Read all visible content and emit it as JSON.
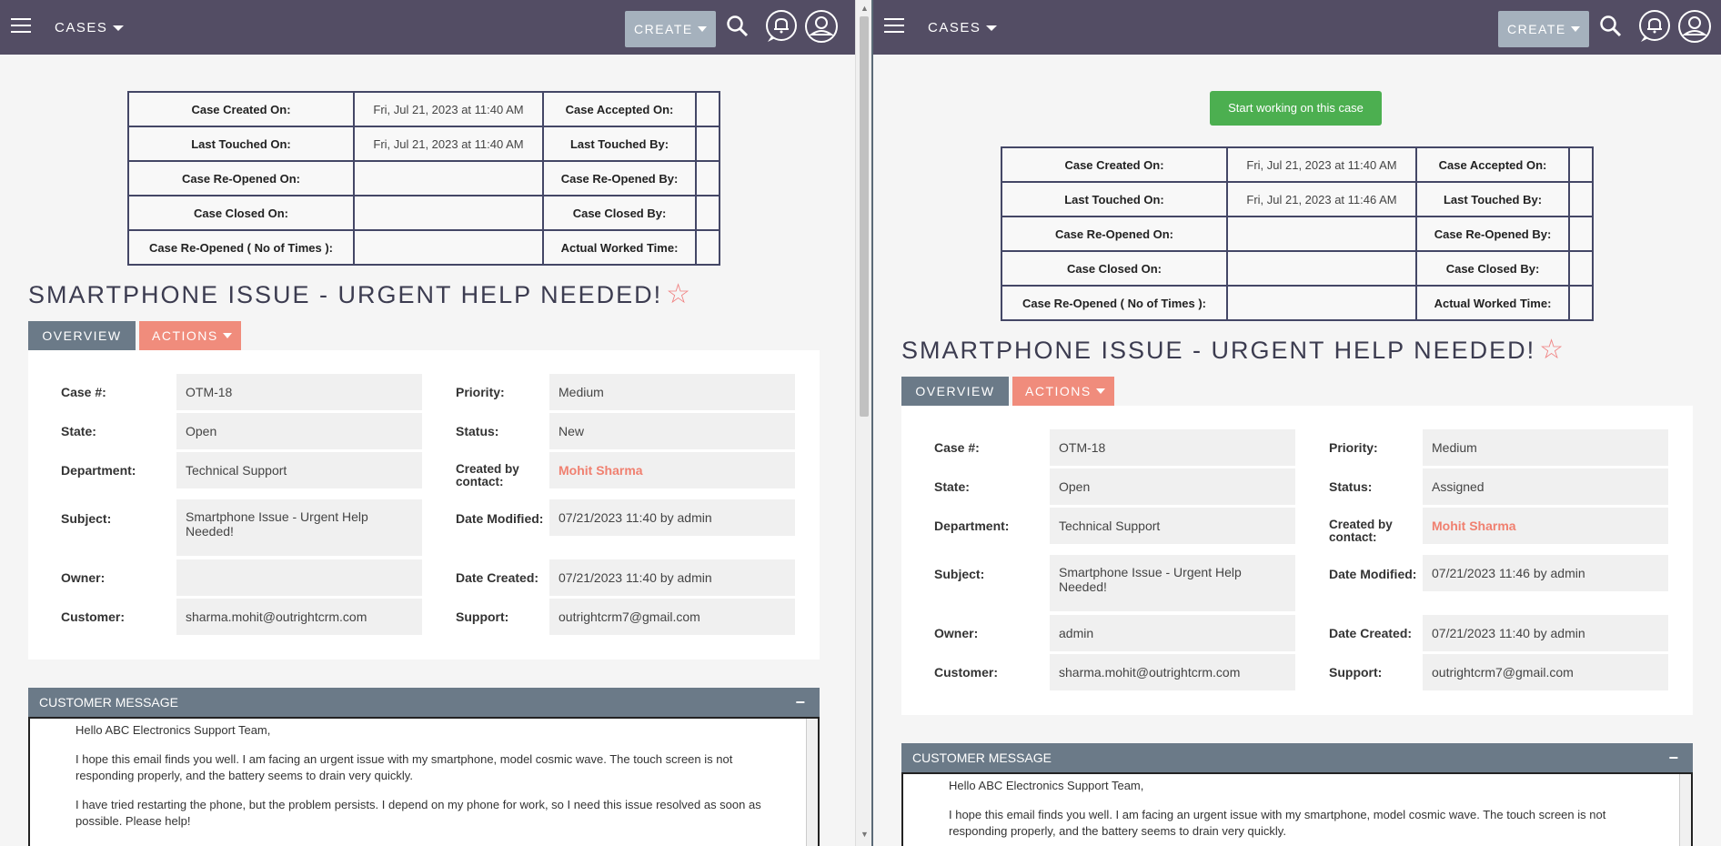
{
  "topbar": {
    "module_label": "CASES",
    "create_label": "CREATE"
  },
  "left": {
    "times": {
      "case_created_on_label": "Case Created On:",
      "case_created_on_value": "Fri, Jul 21, 2023 at 11:40 AM",
      "case_accepted_on_label": "Case Accepted On:",
      "last_touched_on_label": "Last Touched On:",
      "last_touched_on_value": "Fri, Jul 21, 2023 at 11:40 AM",
      "last_touched_by_label": "Last Touched By:",
      "case_reopened_on_label": "Case Re-Opened On:",
      "case_reopened_by_label": "Case Re-Opened By:",
      "case_closed_on_label": "Case Closed On:",
      "case_closed_by_label": "Case Closed By:",
      "case_reopened_count_label": "Case Re-Opened ( No of Times ):",
      "actual_worked_time_label": "Actual Worked Time:"
    },
    "title": "SMARTPHONE ISSUE - URGENT HELP NEEDED!",
    "tabs": {
      "overview": "OVERVIEW",
      "actions": "ACTIONS"
    },
    "fields": {
      "case_num_label": "Case #:",
      "case_num": "OTM-18",
      "priority_label": "Priority:",
      "priority": "Medium",
      "state_label": "State:",
      "state": "Open",
      "status_label": "Status:",
      "status": "New",
      "department_label": "Department:",
      "department": "Technical Support",
      "created_by_label": "Created by contact:",
      "created_by": "Mohit Sharma",
      "subject_label": "Subject:",
      "subject": "Smartphone Issue - Urgent Help Needed!",
      "date_modified_label": "Date Modified:",
      "date_modified": "07/21/2023 11:40 by admin",
      "owner_label": "Owner:",
      "owner": "",
      "date_created_label": "Date Created:",
      "date_created": "07/21/2023 11:40 by admin",
      "customer_label": "Customer:",
      "customer": "sharma.mohit@outrightcrm.com",
      "support_label": "Support:",
      "support": "outrightcrm7@gmail.com"
    },
    "message": {
      "header": "CUSTOMER MESSAGE",
      "collapse": "−",
      "p1": "Hello ABC Electronics Support Team,",
      "p2": "I hope this email finds you well. I am facing an urgent issue with my smartphone, model cosmic wave. The touch screen is not responding properly, and the battery seems to drain very quickly.",
      "p3": "I have tried restarting the phone, but the problem persists. I depend on my phone for work, so I need this issue resolved as soon as possible. Please help!"
    }
  },
  "right": {
    "start_button": "Start working on this case",
    "times": {
      "case_created_on_label": "Case Created On:",
      "case_created_on_value": "Fri, Jul 21, 2023 at 11:40 AM",
      "case_accepted_on_label": "Case Accepted On:",
      "last_touched_on_label": "Last Touched On:",
      "last_touched_on_value": "Fri, Jul 21, 2023 at 11:46 AM",
      "last_touched_by_label": "Last Touched By:",
      "case_reopened_on_label": "Case Re-Opened On:",
      "case_reopened_by_label": "Case Re-Opened By:",
      "case_closed_on_label": "Case Closed On:",
      "case_closed_by_label": "Case Closed By:",
      "case_reopened_count_label": "Case Re-Opened ( No of Times ):",
      "actual_worked_time_label": "Actual Worked Time:"
    },
    "title": "SMARTPHONE ISSUE - URGENT HELP NEEDED!",
    "tabs": {
      "overview": "OVERVIEW",
      "actions": "ACTIONS"
    },
    "fields": {
      "case_num_label": "Case #:",
      "case_num": "OTM-18",
      "priority_label": "Priority:",
      "priority": "Medium",
      "state_label": "State:",
      "state": "Open",
      "status_label": "Status:",
      "status": "Assigned",
      "department_label": "Department:",
      "department": "Technical Support",
      "created_by_label": "Created by contact:",
      "created_by": "Mohit Sharma",
      "subject_label": "Subject:",
      "subject": "Smartphone Issue - Urgent Help Needed!",
      "date_modified_label": "Date Modified:",
      "date_modified": "07/21/2023 11:46 by admin",
      "owner_label": "Owner:",
      "owner": "admin",
      "date_created_label": "Date Created:",
      "date_created": "07/21/2023 11:40 by admin",
      "customer_label": "Customer:",
      "customer": "sharma.mohit@outrightcrm.com",
      "support_label": "Support:",
      "support": "outrightcrm7@gmail.com"
    },
    "message": {
      "header": "CUSTOMER MESSAGE",
      "collapse": "−",
      "p1": "Hello ABC Electronics Support Team,",
      "p2": "I hope this email finds you well. I am facing an urgent issue with my smartphone, model cosmic wave. The touch screen is not responding properly, and the battery seems to drain very quickly."
    }
  },
  "colors": {
    "topbar": "#534d64",
    "accent_actions": "#f08c7c",
    "start_green": "#4caf50",
    "overview_tab": "#6b7a88"
  }
}
